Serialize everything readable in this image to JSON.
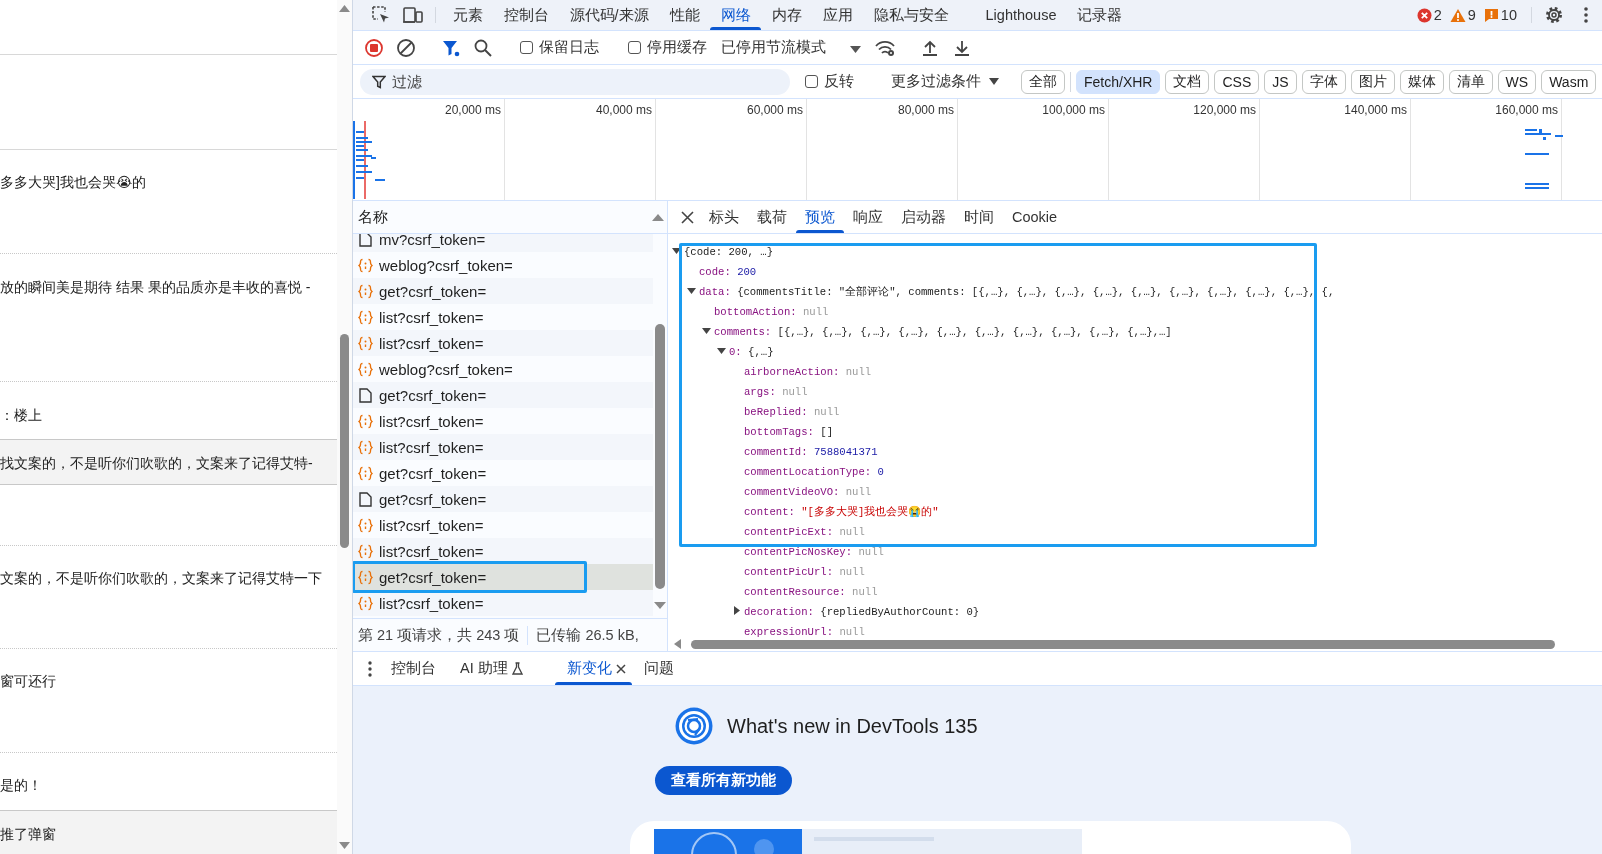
{
  "page": {
    "comments": [
      {
        "text": "多多大哭]我也会哭😭的",
        "shaded": false
      },
      {
        "text": "放的瞬间美是期待 结果 果的品质亦是丰收的喜悦 -",
        "shaded": false
      },
      {
        "text": "：楼上",
        "shaded": false
      },
      {
        "text": "找文案的，不是听你们吹歌的，文案来了记得艾特-",
        "shaded": true
      },
      {
        "text": "文案的，不是听你们吹歌的，文案来了记得艾特一下",
        "shaded": false
      },
      {
        "text": "窗可还行",
        "shaded": false
      },
      {
        "text": "是的！",
        "shaded": false
      },
      {
        "text": "推了弹窗",
        "shaded": true
      }
    ]
  },
  "main_tabs": [
    {
      "label": "元素",
      "selected": false
    },
    {
      "label": "控制台",
      "selected": false
    },
    {
      "label": "源代码/来源",
      "selected": false
    },
    {
      "label": "性能",
      "selected": false
    },
    {
      "label": "网络",
      "selected": true
    },
    {
      "label": "内存",
      "selected": false
    },
    {
      "label": "应用",
      "selected": false
    },
    {
      "label": "隐私与安全",
      "selected": false
    },
    {
      "label": "Lighthouse",
      "selected": false
    },
    {
      "label": "记录器",
      "selected": false
    }
  ],
  "counters": [
    {
      "kind": "error",
      "count": "2"
    },
    {
      "kind": "warning",
      "count": "9"
    },
    {
      "kind": "issue",
      "count": "10"
    }
  ],
  "toolbar": {
    "recording": true,
    "checkboxes": [
      {
        "label": "保留日志",
        "checked": false
      },
      {
        "label": "停用缓存",
        "checked": false
      }
    ],
    "throttling": "已停用节流模式"
  },
  "filter": {
    "placeholder": "过滤",
    "invert": {
      "label": "反转",
      "checked": false
    },
    "more": "更多过滤条件",
    "types": [
      {
        "label": "全部",
        "selected": false
      },
      {
        "label": "Fetch/XHR",
        "selected": true
      },
      {
        "label": "文档",
        "selected": false
      },
      {
        "label": "CSS",
        "selected": false
      },
      {
        "label": "JS",
        "selected": false
      },
      {
        "label": "字体",
        "selected": false
      },
      {
        "label": "图片",
        "selected": false
      },
      {
        "label": "媒体",
        "selected": false
      },
      {
        "label": "清单",
        "selected": false
      },
      {
        "label": "WS",
        "selected": false
      },
      {
        "label": "Wasm",
        "selected": false
      }
    ]
  },
  "timeline": {
    "ticks": [
      "20,000 ms",
      "40,000 ms",
      "60,000 ms",
      "80,000 ms",
      "100,000 ms",
      "120,000 ms",
      "140,000 ms",
      "160,000 ms"
    ]
  },
  "requests": {
    "header": "名称",
    "rows": [
      {
        "name": "mv?csrf_token=",
        "kind": "document",
        "selected": false,
        "outlined": false
      },
      {
        "name": "weblog?csrf_token=",
        "kind": "xhr",
        "selected": false,
        "outlined": false
      },
      {
        "name": "get?csrf_token=",
        "kind": "xhr",
        "selected": false,
        "outlined": false
      },
      {
        "name": "list?csrf_token=",
        "kind": "xhr",
        "selected": false,
        "outlined": false
      },
      {
        "name": "list?csrf_token=",
        "kind": "xhr",
        "selected": false,
        "outlined": false
      },
      {
        "name": "weblog?csrf_token=",
        "kind": "xhr",
        "selected": false,
        "outlined": false
      },
      {
        "name": "get?csrf_token=",
        "kind": "document",
        "selected": false,
        "outlined": false
      },
      {
        "name": "list?csrf_token=",
        "kind": "xhr",
        "selected": false,
        "outlined": false
      },
      {
        "name": "list?csrf_token=",
        "kind": "xhr",
        "selected": false,
        "outlined": false
      },
      {
        "name": "get?csrf_token=",
        "kind": "xhr",
        "selected": false,
        "outlined": false
      },
      {
        "name": "get?csrf_token=",
        "kind": "document",
        "selected": false,
        "outlined": false
      },
      {
        "name": "list?csrf_token=",
        "kind": "xhr",
        "selected": false,
        "outlined": false
      },
      {
        "name": "list?csrf_token=",
        "kind": "xhr",
        "selected": false,
        "outlined": false
      },
      {
        "name": "get?csrf_token=",
        "kind": "xhr",
        "selected": true,
        "outlined": true
      },
      {
        "name": "list?csrf_token=",
        "kind": "xhr",
        "selected": false,
        "outlined": false
      }
    ],
    "status": [
      "第 21 项请求，共 243 项",
      "已传输 26.5 kB,"
    ]
  },
  "detail_tabs": [
    {
      "label": "标头",
      "selected": false
    },
    {
      "label": "载荷",
      "selected": false
    },
    {
      "label": "预览",
      "selected": true
    },
    {
      "label": "响应",
      "selected": false
    },
    {
      "label": "启动器",
      "selected": false
    },
    {
      "label": "时间",
      "selected": false
    },
    {
      "label": "Cookie",
      "selected": false
    }
  ],
  "preview": {
    "outlined": true,
    "tree": {
      "value": "{code: 200, …}",
      "kind": "plain",
      "expanded": true,
      "children": [
        {
          "key": "code:",
          "value": "200",
          "kind": "number"
        },
        {
          "key": "data:",
          "value": "{commentsTitle: \"全部评论\", comments: [{,…}, {,…}, {,…}, {,…}, {,…}, {,…}, {,…}, {,…}, {,…}, {,",
          "kind": "plain",
          "expanded": true,
          "children": [
            {
              "key": "bottomAction:",
              "value": "null",
              "kind": "null"
            },
            {
              "key": "comments:",
              "value": "[{,…}, {,…}, {,…}, {,…}, {,…}, {,…}, {,…}, {,…}, {,…}, {,…},…]",
              "kind": "plain",
              "expanded": true,
              "children": [
                {
                  "key": "0:",
                  "value": "{,…}",
                  "kind": "plain",
                  "expanded": true,
                  "children": [
                    {
                      "key": "airborneAction:",
                      "value": "null",
                      "kind": "null"
                    },
                    {
                      "key": "args:",
                      "value": "null",
                      "kind": "null"
                    },
                    {
                      "key": "beReplied:",
                      "value": "null",
                      "kind": "null"
                    },
                    {
                      "key": "bottomTags:",
                      "value": "[]",
                      "kind": "plain"
                    },
                    {
                      "key": "commentId:",
                      "value": "7588041371",
                      "kind": "number"
                    },
                    {
                      "key": "commentLocationType:",
                      "value": "0",
                      "kind": "number"
                    },
                    {
                      "key": "commentVideoVO:",
                      "value": "null",
                      "kind": "null"
                    },
                    {
                      "key": "content:",
                      "value": "\"[多多大哭]我也会哭😭的\"",
                      "kind": "string"
                    },
                    {
                      "key": "contentPicExt:",
                      "value": "null",
                      "kind": "null"
                    },
                    {
                      "key": "contentPicNosKey:",
                      "value": "null",
                      "kind": "null"
                    },
                    {
                      "key": "contentPicUrl:",
                      "value": "null",
                      "kind": "null"
                    },
                    {
                      "key": "contentResource:",
                      "value": "null",
                      "kind": "null"
                    },
                    {
                      "key": "decoration:",
                      "value": "{repliedByAuthorCount: 0}",
                      "kind": "plain",
                      "expanded": false
                    },
                    {
                      "key": "expressionUrl:",
                      "value": "null",
                      "kind": "null"
                    }
                  ]
                }
              ]
            }
          ]
        }
      ]
    }
  },
  "drawer": {
    "tabs": [
      {
        "label": "控制台",
        "selected": false,
        "kind": "plain"
      },
      {
        "label": "AI 助理",
        "selected": false,
        "kind": "experimental"
      },
      {
        "label": "新变化",
        "selected": true,
        "kind": "closable"
      },
      {
        "label": "问题",
        "selected": false,
        "kind": "plain"
      }
    ],
    "title": "What's new in DevTools 135",
    "button": "查看所有新功能"
  }
}
